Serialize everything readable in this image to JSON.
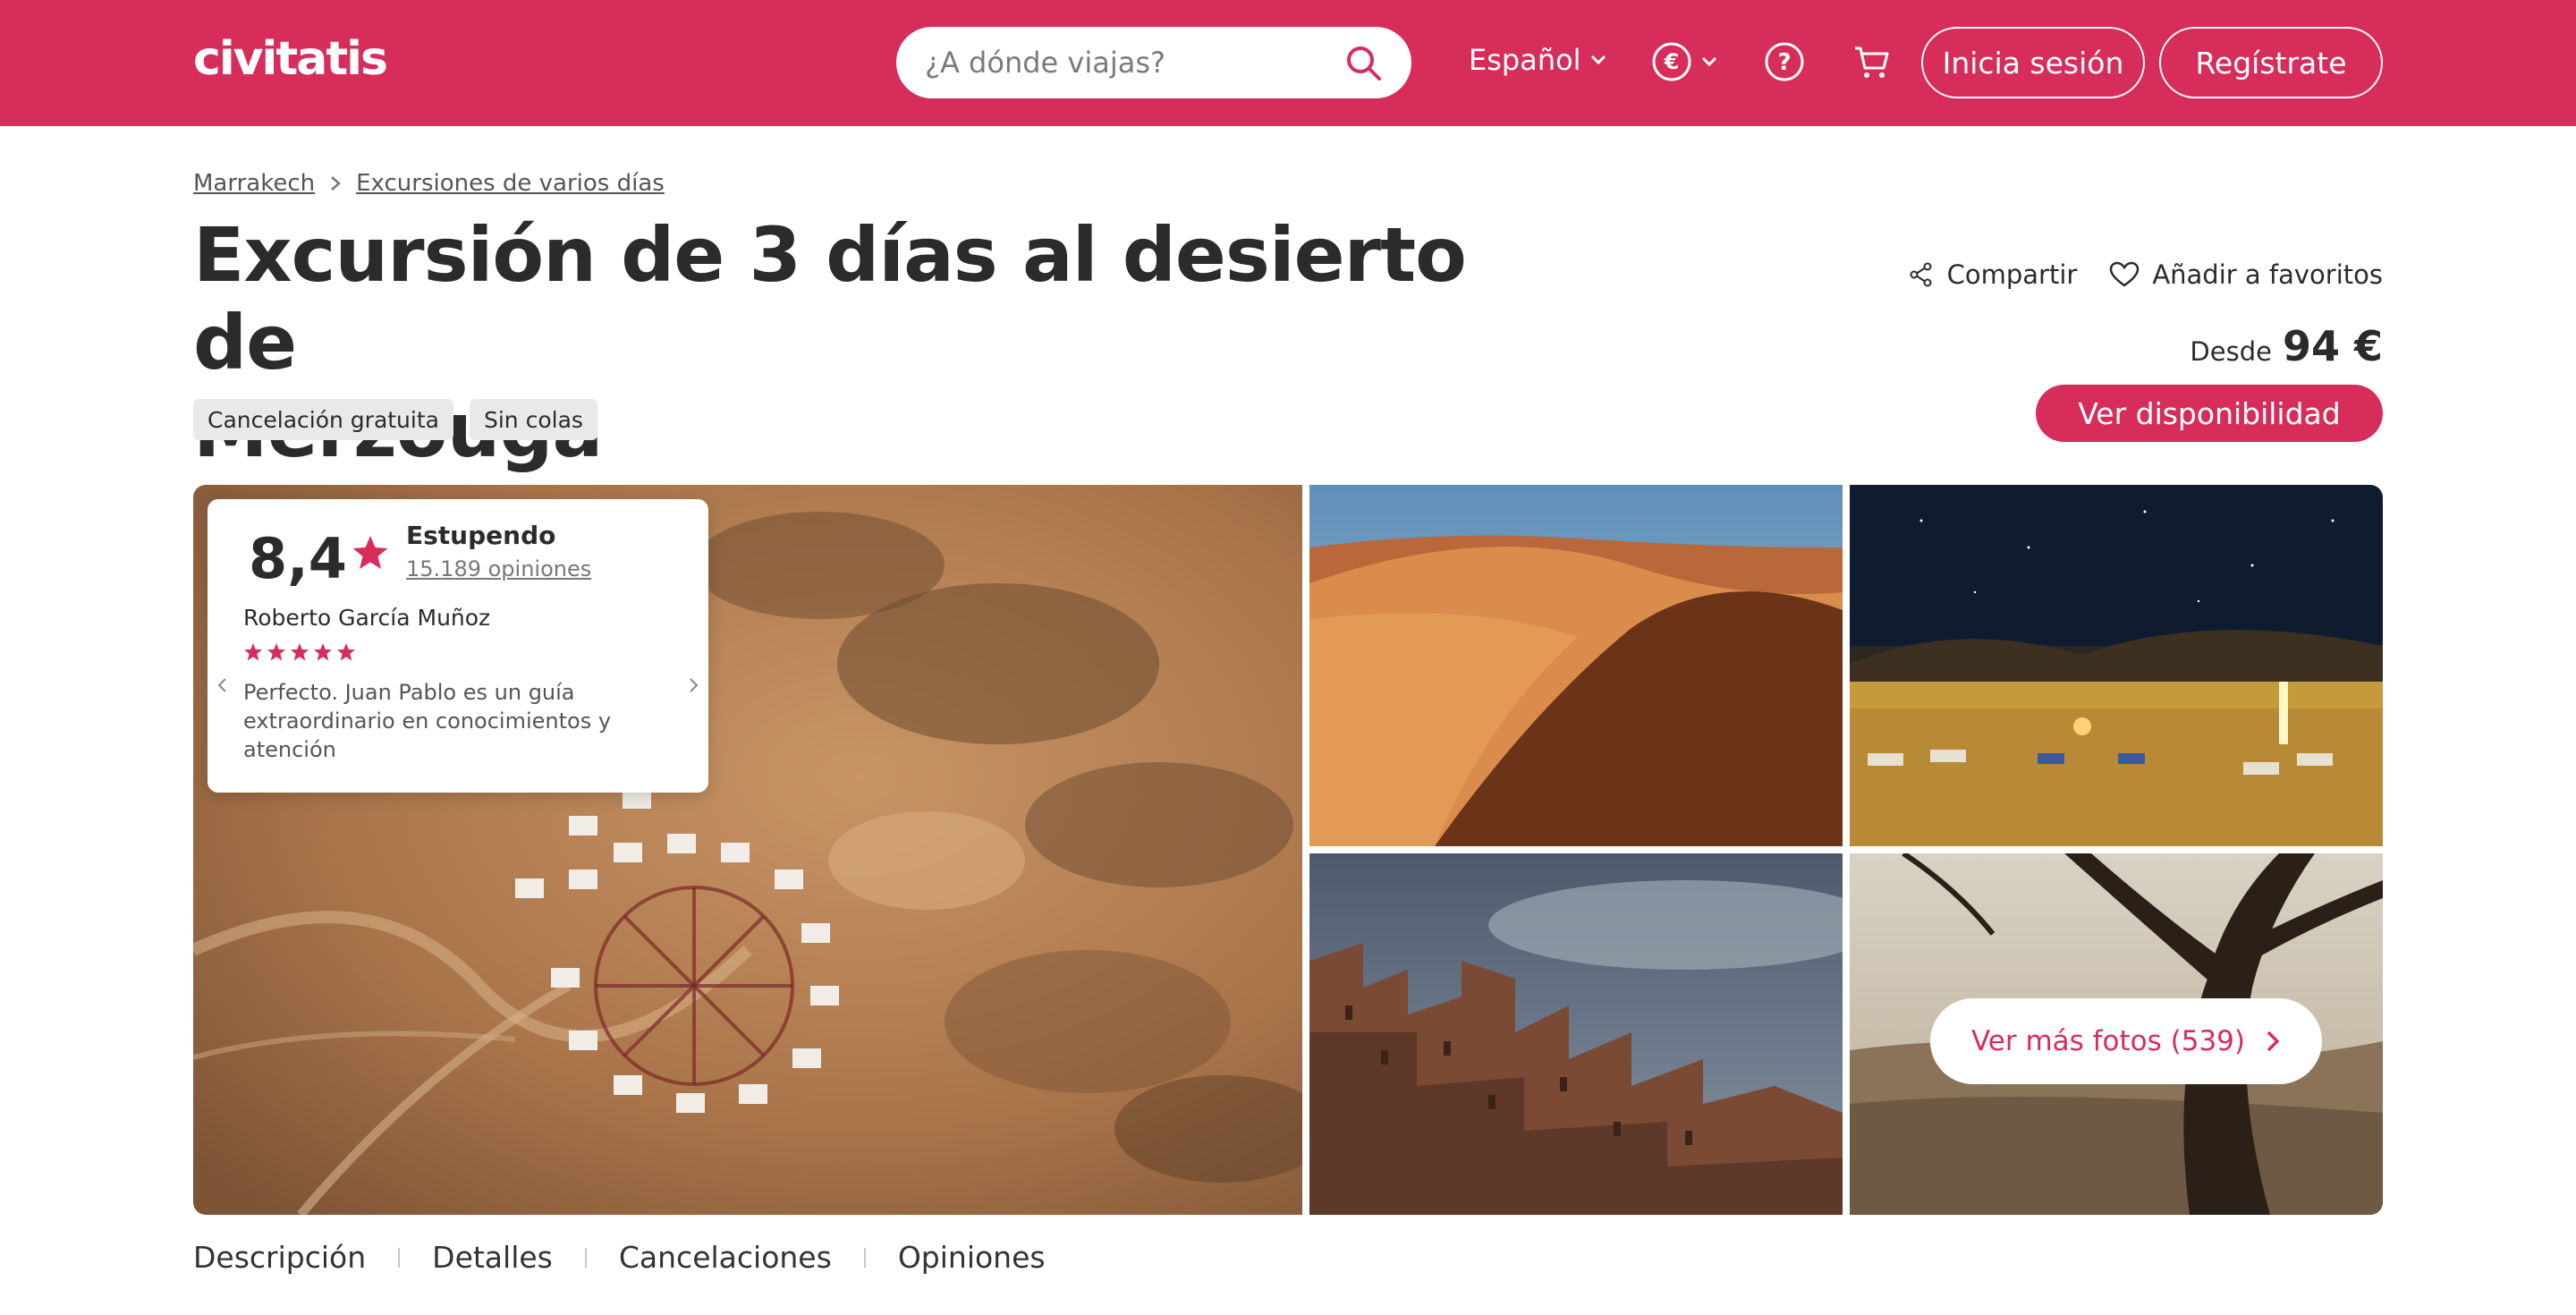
{
  "header": {
    "logo": "civitatis",
    "search_placeholder": "¿A dónde viajas?",
    "language": "Español",
    "currency_icon": "euro-icon",
    "help_icon": "question-icon",
    "cart_icon": "cart-icon",
    "login": "Inicia sesión",
    "register": "Regístrate",
    "brand_color": "#d62d5b"
  },
  "breadcrumb": [
    "Marrakech",
    "Excursiones de varios días"
  ],
  "title_line1": "Excursión de 3 días al desierto de",
  "title_line2": "Merzouga",
  "tags": [
    "Cancelación gratuita",
    "Sin colas"
  ],
  "actions": {
    "share": "Compartir",
    "favorite": "Añadir a favoritos"
  },
  "price": {
    "from": "Desde",
    "amount": "94 €"
  },
  "cta": "Ver disponibilidad",
  "rating": {
    "score": "8,4",
    "word": "Estupendo",
    "count": "15.189 opiniones",
    "reviewer": "Roberto García Muñoz",
    "stars": 5,
    "review": "Perfecto. Juan Pablo es un guía extraordinario en conocimientos y atención"
  },
  "more_photos": "Ver más fotos (539)",
  "tabs": [
    "Descripción",
    "Detalles",
    "Cancelaciones",
    "Opiniones"
  ]
}
